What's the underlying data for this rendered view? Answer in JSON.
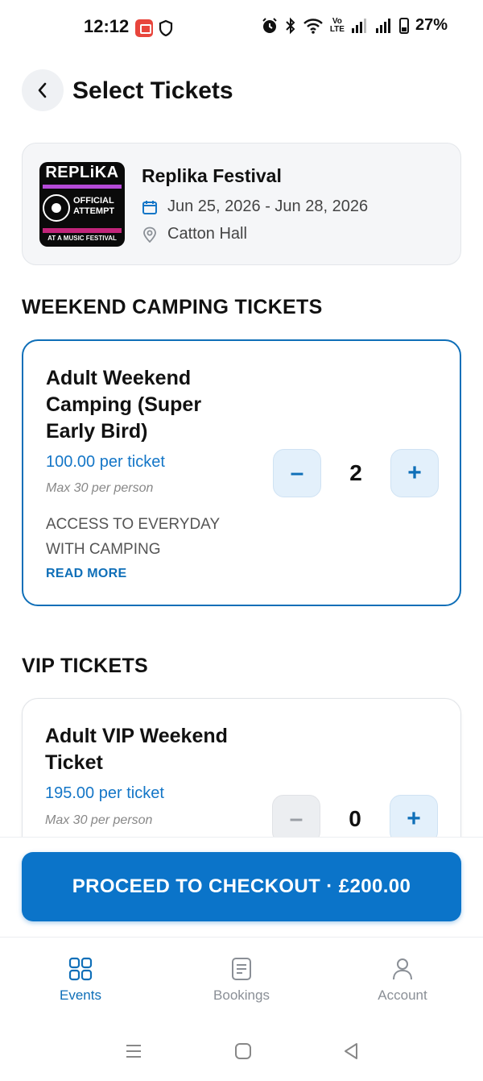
{
  "status_bar": {
    "time": "12:12",
    "volte_top": "Vo",
    "volte_bottom": "LTE",
    "battery": "27%"
  },
  "header": {
    "title": "Select Tickets"
  },
  "event": {
    "name": "Replika Festival",
    "dates": "Jun 25, 2026 - Jun 28, 2026",
    "venue": "Catton Hall",
    "logo": {
      "top_text": "REPLiKA",
      "middle_text": "OFFICIAL ATTEMPT",
      "bottom_text": "AT A MUSIC FESTIVAL"
    }
  },
  "sections": [
    {
      "title": "WEEKEND CAMPING TICKETS",
      "ticket": {
        "name": "Adult Weekend Camping (Super Early Bird)",
        "price": "100.00 per ticket",
        "max": "Max 30 per person",
        "description": "ACCESS TO EVERYDAY WITH CAMPING",
        "read_more": "READ MORE",
        "quantity": "2",
        "minus": "–",
        "plus": "+"
      }
    },
    {
      "title": "VIP TICKETS",
      "ticket": {
        "name": "Adult VIP Weekend Ticket",
        "price": "195.00 per ticket",
        "max": "Max 30 per person",
        "quantity": "0",
        "minus": "–",
        "plus": "+"
      }
    }
  ],
  "checkout": {
    "label": "PROCEED TO CHECKOUT · £200.00"
  },
  "bottom_nav": [
    {
      "label": "Events",
      "icon": "grid-icon",
      "active": true
    },
    {
      "label": "Bookings",
      "icon": "document-icon",
      "active": false
    },
    {
      "label": "Account",
      "icon": "user-icon",
      "active": false
    }
  ],
  "colors": {
    "accent": "#0f6fb8",
    "button": "#0b74c9",
    "price": "#1476c7"
  }
}
